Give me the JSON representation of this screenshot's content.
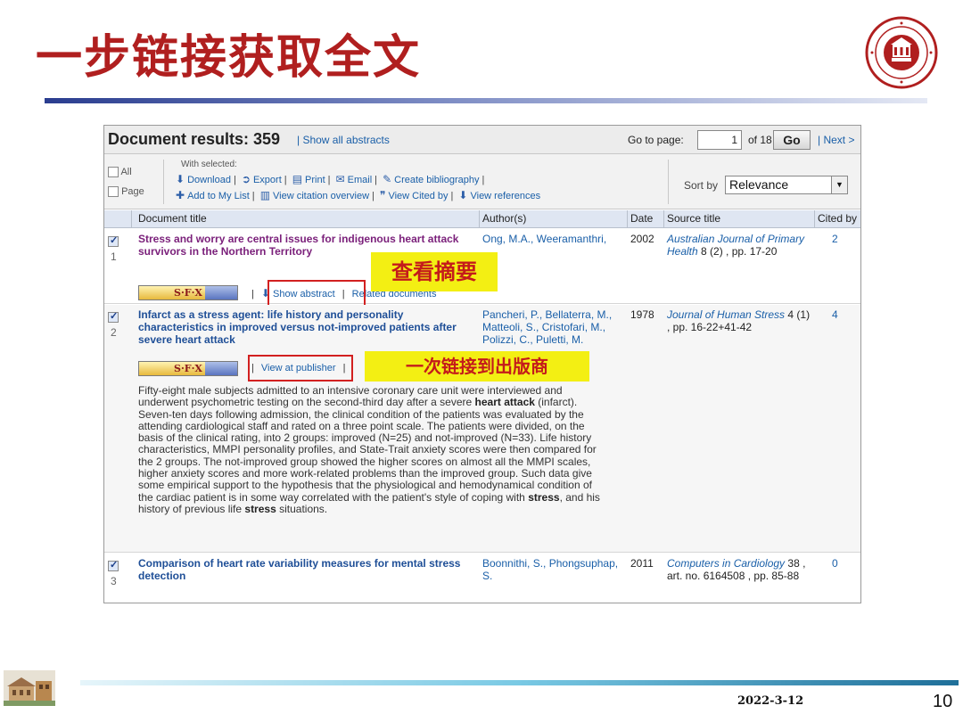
{
  "slide": {
    "title": "一步链接获取全文",
    "date": "2022-3-12",
    "page_number": "10",
    "logo_icon": "university-seal-icon",
    "footer_icon": "campus-building-photo-icon",
    "accent_color": "#b01f1f"
  },
  "results": {
    "heading": "Document results: 359",
    "show_all": "| Show all abstracts",
    "go_to_label": "Go to page:",
    "page_value": "1",
    "of_pages": "of 18",
    "go_label": "Go",
    "next_label": "| Next >"
  },
  "toolbar": {
    "all_label": "All",
    "page_label": "Page",
    "with_selected": "With selected:",
    "download": "Download",
    "export": "Export",
    "print": "Print",
    "email": "Email",
    "create_bibliography": "Create bibliography",
    "add_to_list": "Add to My List",
    "view_citation_overview": "View citation overview",
    "view_cited_by": "View Cited by",
    "view_references": "View references",
    "sort_label": "Sort by",
    "sort_value": "Relevance"
  },
  "columns": [
    "Document title",
    "Author(s)",
    "Date",
    "Source title",
    "Cited by"
  ],
  "rows": [
    {
      "num": "1",
      "title": "Stress and worry are central issues for indigenous heart attack survivors in the Northern Territory",
      "authors": "Ong, M.A., Weeramanthri,",
      "date": "2002",
      "journal": "Australian Journal of Primary Health",
      "source_detail": " 8 (2) , pp. 17-20",
      "cited": "2",
      "sfx_label": "S·F·X",
      "show_abstract": "Show abstract",
      "related": "Related documents"
    },
    {
      "num": "2",
      "title": "Infarct as a stress agent: life history and personality characteristics in improved versus not-improved patients after severe heart attack",
      "authors": "Pancheri, P., Bellaterra, M., Matteoli, S., Cristofari, M., Polizzi, C., Puletti, M.",
      "date": "1978",
      "journal": "Journal of Human Stress",
      "source_detail": " 4 (1) , pp. 16-22+41-42",
      "cited": "4",
      "sfx_label": "S·F·X",
      "view_publisher": "View at publisher",
      "abstract_parts": [
        "Fifty-eight male subjects admitted to an intensive coronary care unit were interviewed and underwent psychometric testing on the second-third day after a severe ",
        "heart attack",
        " (infarct). Seven-ten days following admission, the clinical condition of the patients was evaluated by the attending cardiological staff and rated on a three point scale. The patients were divided, on the basis of the clinical rating, into 2 groups: improved (N=25) and not-improved (N=33). Life history characteristics, MMPI personality profiles, and State-Trait anxiety scores were then compared for the 2 groups. The not-improved group showed the higher scores on almost all the MMPI scales, higher anxiety scores and more work-related problems than the improved group. Such data give some empirical support to the hypothesis that the physiological and hemodynamical condition of the cardiac patient is in some way correlated with the patient's style of coping with ",
        "stress",
        ", and his history of previous life ",
        "stress",
        " situations."
      ]
    },
    {
      "num": "3",
      "title": "Comparison of heart rate variability measures for mental stress detection",
      "authors": "Boonnithi, S., Phongsuphap, S.",
      "date": "2011",
      "journal": "Computers in Cardiology",
      "source_detail": " 38 , art. no. 6164508 , pp. 85-88",
      "cited": "0"
    }
  ],
  "callouts": {
    "abstract": "查看摘要",
    "publisher": "一次链接到出版商"
  }
}
